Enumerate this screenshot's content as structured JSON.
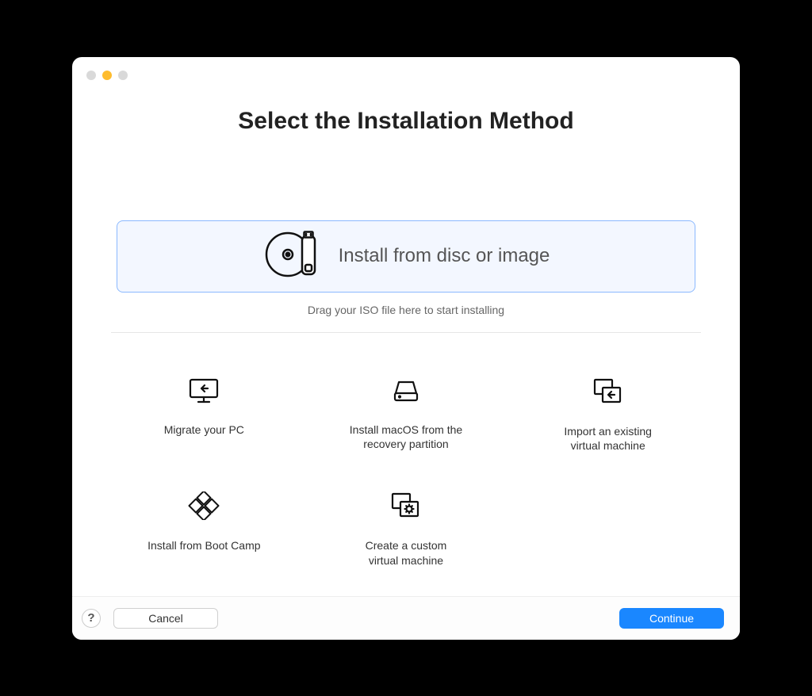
{
  "title": "Select the Installation Method",
  "dropzone": {
    "label": "Install from disc or image",
    "hint": "Drag your ISO file here to start installing"
  },
  "options": {
    "migrate": "Migrate your PC",
    "macos_recovery": "Install macOS from the\nrecovery partition",
    "import_vm": "Import an existing\nvirtual machine",
    "bootcamp": "Install from Boot Camp",
    "custom_vm": "Create a custom\nvirtual machine"
  },
  "footer": {
    "help": "?",
    "cancel": "Cancel",
    "continue": "Continue"
  }
}
